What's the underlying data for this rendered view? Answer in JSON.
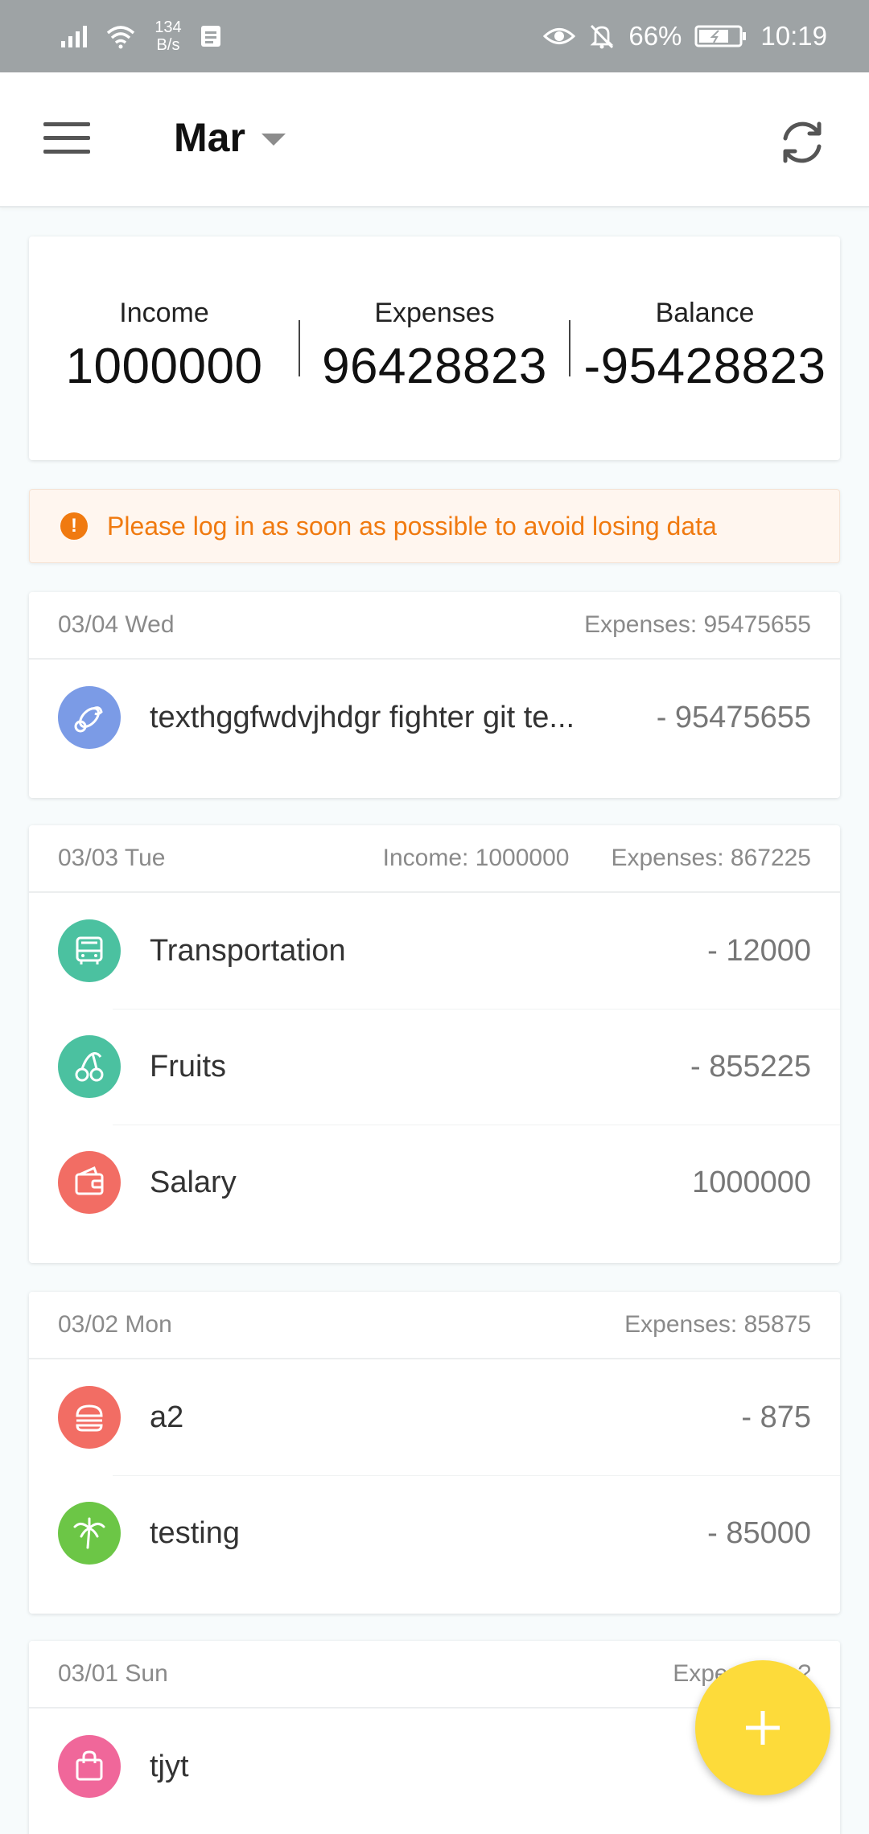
{
  "status_bar": {
    "net_speed_value": "134",
    "net_speed_unit": "B/s",
    "battery": "66%",
    "time": "10:19"
  },
  "app_bar": {
    "month": "Mar"
  },
  "summary": {
    "income_label": "Income",
    "income_value": "1000000",
    "expenses_label": "Expenses",
    "expenses_value": "96428823",
    "balance_label": "Balance",
    "balance_value": "-95428823"
  },
  "alert": {
    "icon": "!",
    "text": "Please log in as soon as possible to avoid losing data"
  },
  "days": [
    {
      "date": "03/04 Wed",
      "expenses": "Expenses: 95475655",
      "items": [
        {
          "name": "texthggfwdvjhdgr fighter git te...",
          "amount": "- 95475655",
          "icon": "pacifier-icon",
          "color": "#7b9be6"
        }
      ]
    },
    {
      "date": "03/03 Tue",
      "income": "Income: 1000000",
      "expenses": "Expenses: 867225",
      "items": [
        {
          "name": "Transportation",
          "amount": "- 12000",
          "icon": "bus-icon",
          "color": "#4bc1a0"
        },
        {
          "name": "Fruits",
          "amount": "- 855225",
          "icon": "cherry-icon",
          "color": "#4bc1a0"
        },
        {
          "name": "Salary",
          "amount": "1000000",
          "icon": "wallet-icon",
          "color": "#f26d64"
        }
      ]
    },
    {
      "date": "03/02 Mon",
      "expenses": "Expenses: 85875",
      "items": [
        {
          "name": "a2",
          "amount": "- 875",
          "icon": "burger-icon",
          "color": "#f26d64"
        },
        {
          "name": "testing",
          "amount": "- 85000",
          "icon": "palm-tree-icon",
          "color": "#6cc646"
        }
      ]
    },
    {
      "date": "03/01 Sun",
      "expenses_partial": "Expen",
      "expenses_partial_tail": "?",
      "items": [
        {
          "name": "tjyt",
          "amount": "",
          "icon": "shopping-bag-icon",
          "color": "#f0679a"
        }
      ]
    }
  ],
  "colors": {
    "accent_fab": "#fddb3a",
    "alert_text": "#f07a10",
    "status_bar": "#9ea3a5"
  }
}
